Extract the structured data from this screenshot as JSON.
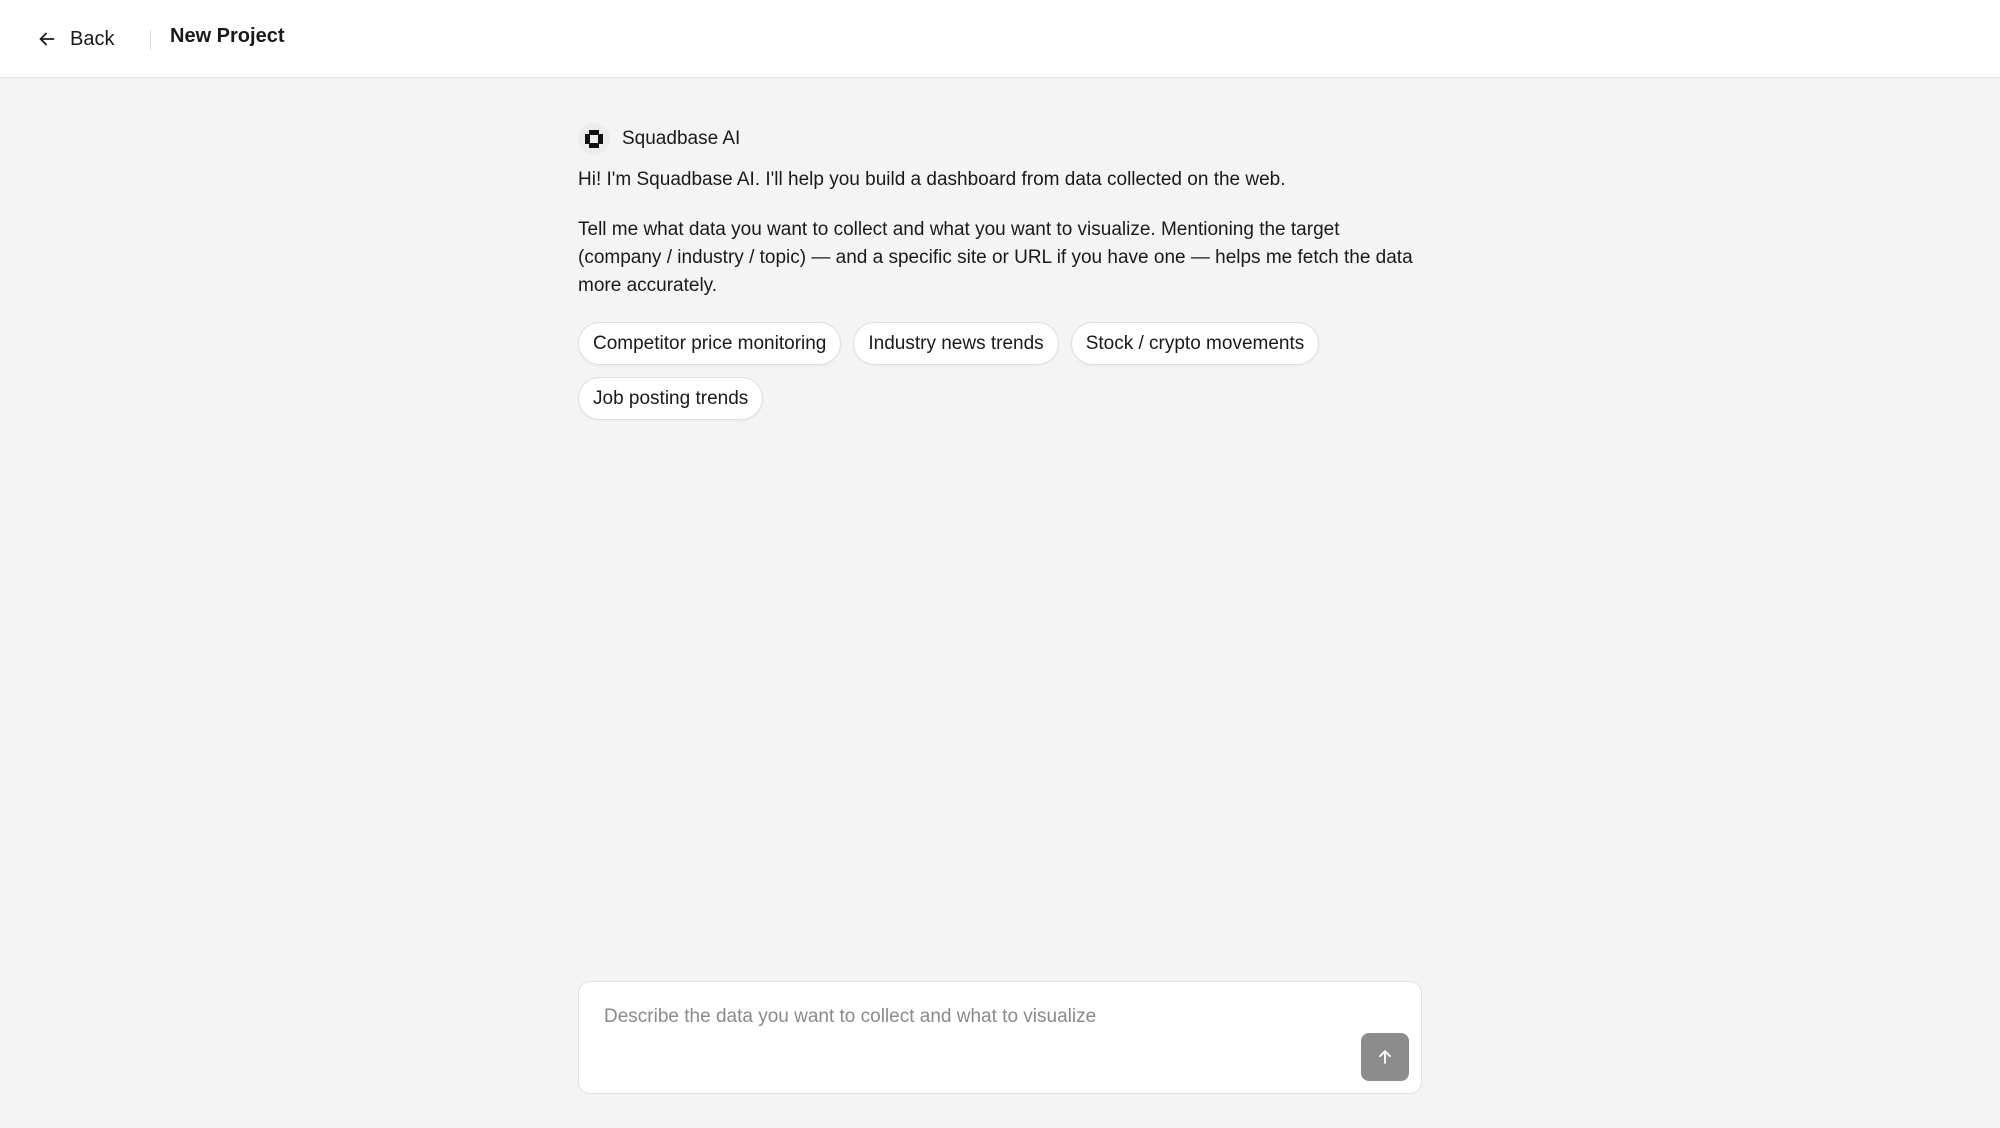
{
  "header": {
    "back_label": "Back",
    "back_icon": "arrow-left-icon",
    "title": "New Project"
  },
  "assistant": {
    "name": "Squadbase AI",
    "avatar_icon": "squadbase-logo-icon",
    "messages": [
      "Hi! I'm Squadbase AI. I'll help you build a dashboard from data collected on the web.",
      "Tell me what data you want to collect and what you want to visualize. Mentioning the target (company / industry / topic) — and a specific site or URL if you have one — helps me fetch the data more accurately."
    ],
    "suggestions": [
      "Competitor price monitoring",
      "Industry news trends",
      "Stock / crypto movements",
      "Job posting trends"
    ]
  },
  "composer": {
    "placeholder": "Describe the data you want to collect and what to visualize",
    "value": "",
    "send_icon": "arrow-up-icon"
  },
  "colors": {
    "background": "#f4f4f4",
    "surface": "#ffffff",
    "send_button": "#8c8c8c"
  }
}
